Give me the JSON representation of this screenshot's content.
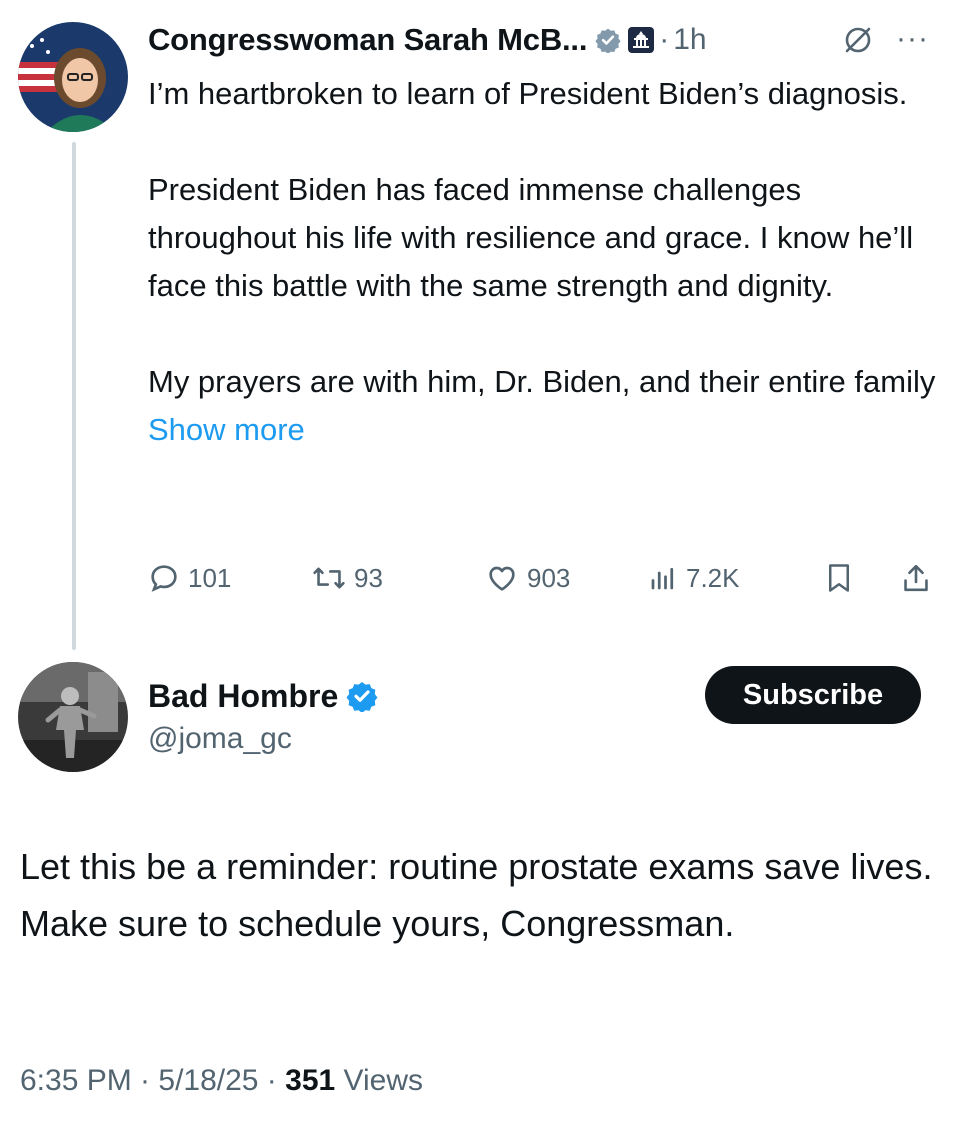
{
  "quoted_tweet": {
    "author_name": "Congresswoman Sarah McB...",
    "separator": "·",
    "time": "1h",
    "more_menu": "···",
    "icons": {
      "avatar": "profile-photo",
      "verified": "gray-verified-badge",
      "affiliation": "capitol-building-badge",
      "grok": "grok-icon"
    },
    "paragraphs": [
      "I’m heartbroken to learn of President Biden’s diagnosis.",
      "President Biden has faced immense challenges throughout his life with resilience and grace. I know he’ll face this battle with the same strength and dignity."
    ],
    "last_paragraph": "My prayers are with him, Dr. Biden, and their entire family",
    "show_more": "Show more",
    "actions": {
      "replies": "101",
      "reposts": "93",
      "likes": "903",
      "views": "7.2K"
    }
  },
  "reply_tweet": {
    "author_name": "Bad Hombre",
    "handle": "@joma_gc",
    "subscribe_label": "Subscribe",
    "text": "Let this be a reminder: routine prostate exams save lives. Make sure to schedule yours, Congressman.",
    "timestamp": "6:35 PM · 5/18/25 · ",
    "views_count": "351",
    "views_label": " Views"
  },
  "colors": {
    "text": "#0f1419",
    "secondary": "#536471",
    "link": "#1d9bf0",
    "verified_blue": "#1d9bf0",
    "verified_gray": "#829aab",
    "thread_line": "#cfd9de"
  }
}
